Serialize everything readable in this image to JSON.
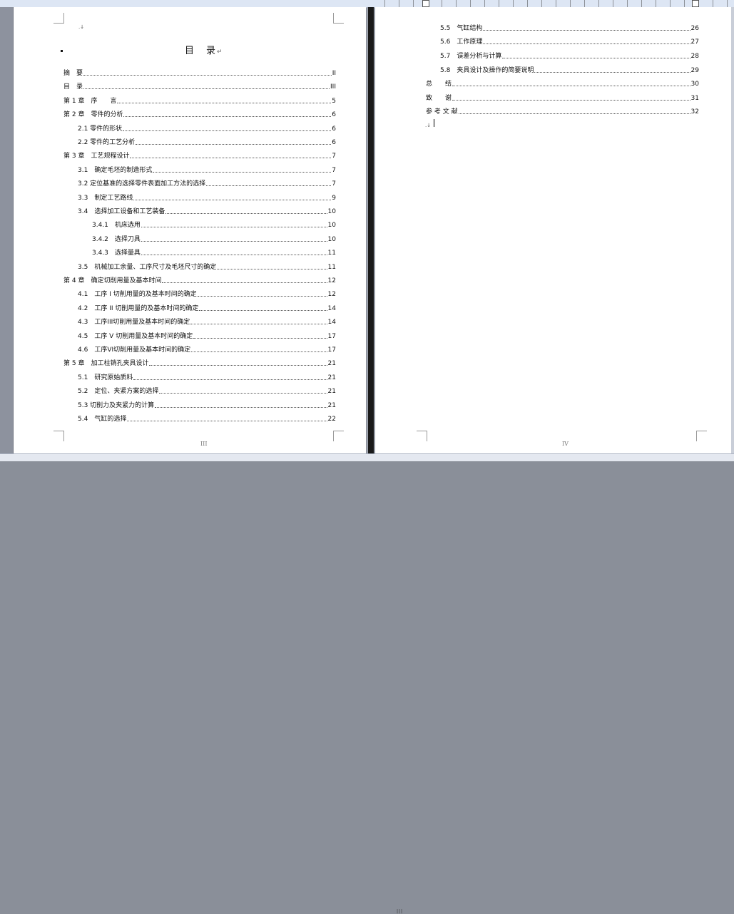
{
  "page_left": {
    "title": "目　录",
    "title_mark": "↵",
    "page_number": "III",
    "entries": [
      {
        "text": "摘　要",
        "page": "II"
      },
      {
        "text": "目　录",
        "page": "III"
      },
      {
        "text": "第 1 章　序　　言",
        "page": "5"
      },
      {
        "text": "第 2 章　零件的分析",
        "page": "6"
      },
      {
        "text": "2.1 零件的形状",
        "page": "6"
      },
      {
        "text": "2.2 零件的工艺分析",
        "page": "6"
      },
      {
        "text": "第 3 章　工艺规程设计",
        "page": "7"
      },
      {
        "text": "3.1　确定毛坯的制造形式",
        "page": "7"
      },
      {
        "text": "3.2 定位基准的选择零件表面加工方法的选择",
        "page": "7"
      },
      {
        "text": "3.3　制定工艺路线",
        "page": "9"
      },
      {
        "text": "3.4　选择加工设备和工艺装备",
        "page": "10"
      },
      {
        "text": "3.4.1　机床选用",
        "page": "10"
      },
      {
        "text": "3.4.2　选择刀具",
        "page": "10"
      },
      {
        "text": "3.4.3　选择量具",
        "page": "11"
      },
      {
        "text": "3.5　机械加工余量、工序尺寸及毛坯尺寸的确定",
        "page": "11"
      },
      {
        "text": "第 4 章　确定切削用量及基本时间",
        "page": "12"
      },
      {
        "text": "4.1　工序 I 切削用量的及基本时间的确定",
        "page": "12"
      },
      {
        "text": "4.2　工序 II 切削用量的及基本时间的确定",
        "page": "14"
      },
      {
        "text": "4.3　工序III切削用量及基本时间的确定",
        "page": "14"
      },
      {
        "text": "4.5　工序 V 切削用量及基本时间的确定",
        "page": "17"
      },
      {
        "text": "4.6　工序VI切削用量及基本时间的确定",
        "page": "17"
      },
      {
        "text": "第 5 章　加工柱销孔夹具设计",
        "page": "21"
      },
      {
        "text": "5.1　研究原始质料",
        "page": "21"
      },
      {
        "text": "5.2　定位、夹紧方案的选择",
        "page": "21"
      },
      {
        "text": "5.3 切削力及夹紧力的计算",
        "page": "21"
      },
      {
        "text": "5.4　气缸的选择",
        "page": "22"
      }
    ]
  },
  "page_right": {
    "page_number": "IV",
    "entries": [
      {
        "text": "5.5　气缸结构",
        "page": "26"
      },
      {
        "text": "5.6　工作原理",
        "page": "27"
      },
      {
        "text": "5.7　误差分析与计算",
        "page": "28"
      },
      {
        "text": "5.8　夹具设计及操作的简要说明",
        "page": "29"
      },
      {
        "text": "总　　结",
        "page": "30"
      },
      {
        "text": "致　　谢",
        "page": "31"
      },
      {
        "text": "参 考 文 献",
        "page": "32"
      }
    ]
  },
  "status": {
    "split_handle": "|||"
  }
}
